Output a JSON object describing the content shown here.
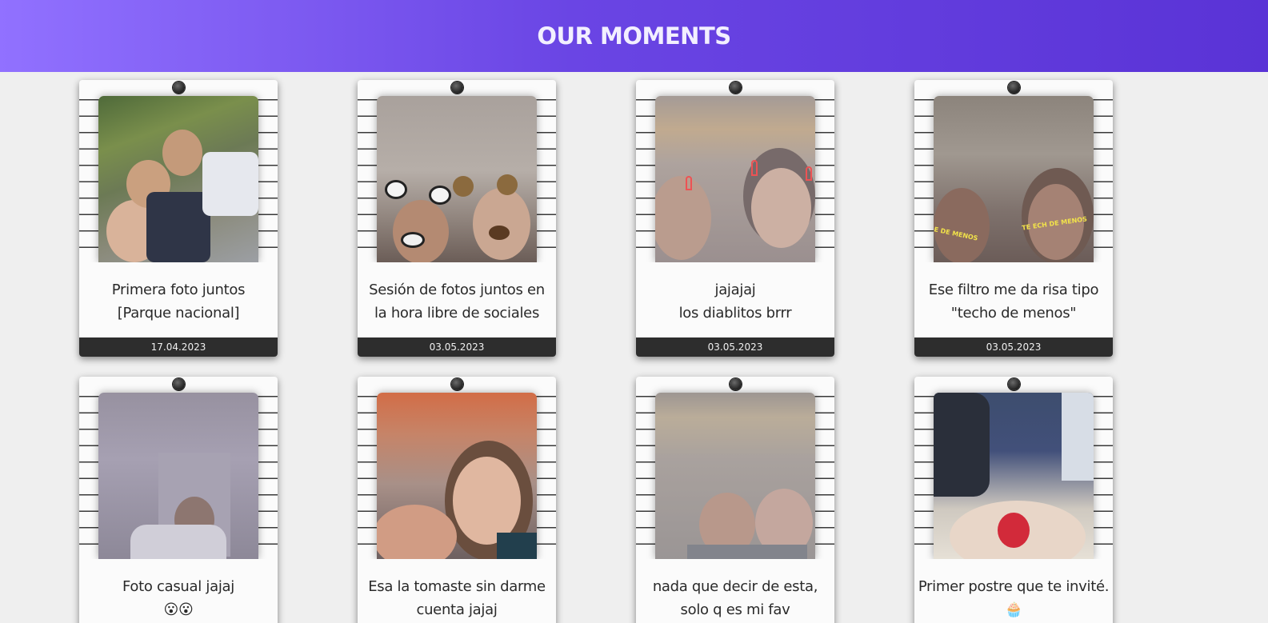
{
  "header": {
    "title": "OUR MOMENTS"
  },
  "cards": [
    {
      "caption": [
        "Primera foto juntos",
        "[Parque nacional]"
      ],
      "date": "17.04.2023"
    },
    {
      "caption": [
        "Sesión de fotos juntos en",
        "la hora libre de sociales"
      ],
      "date": "03.05.2023"
    },
    {
      "caption": [
        "jajajaj",
        "los diablitos brrr"
      ],
      "date": "03.05.2023"
    },
    {
      "caption": [
        "Ese filtro me da risa tipo",
        "\"techo de menos\""
      ],
      "date": "03.05.2023"
    },
    {
      "caption": [
        "Foto casual jajaj",
        "😮😮"
      ],
      "date": ""
    },
    {
      "caption": [
        "Esa la tomaste sin darme",
        "cuenta jajaj"
      ],
      "date": ""
    },
    {
      "caption": [
        "nada que decir de esta,",
        "solo q es mi fav"
      ],
      "date": ""
    },
    {
      "caption": [
        "Primer postre que te invité.",
        "🧁"
      ],
      "date": ""
    }
  ],
  "filter_text": {
    "card4_left": "E DE MENOS",
    "card4_right": "TE ECH DE MENOS"
  }
}
